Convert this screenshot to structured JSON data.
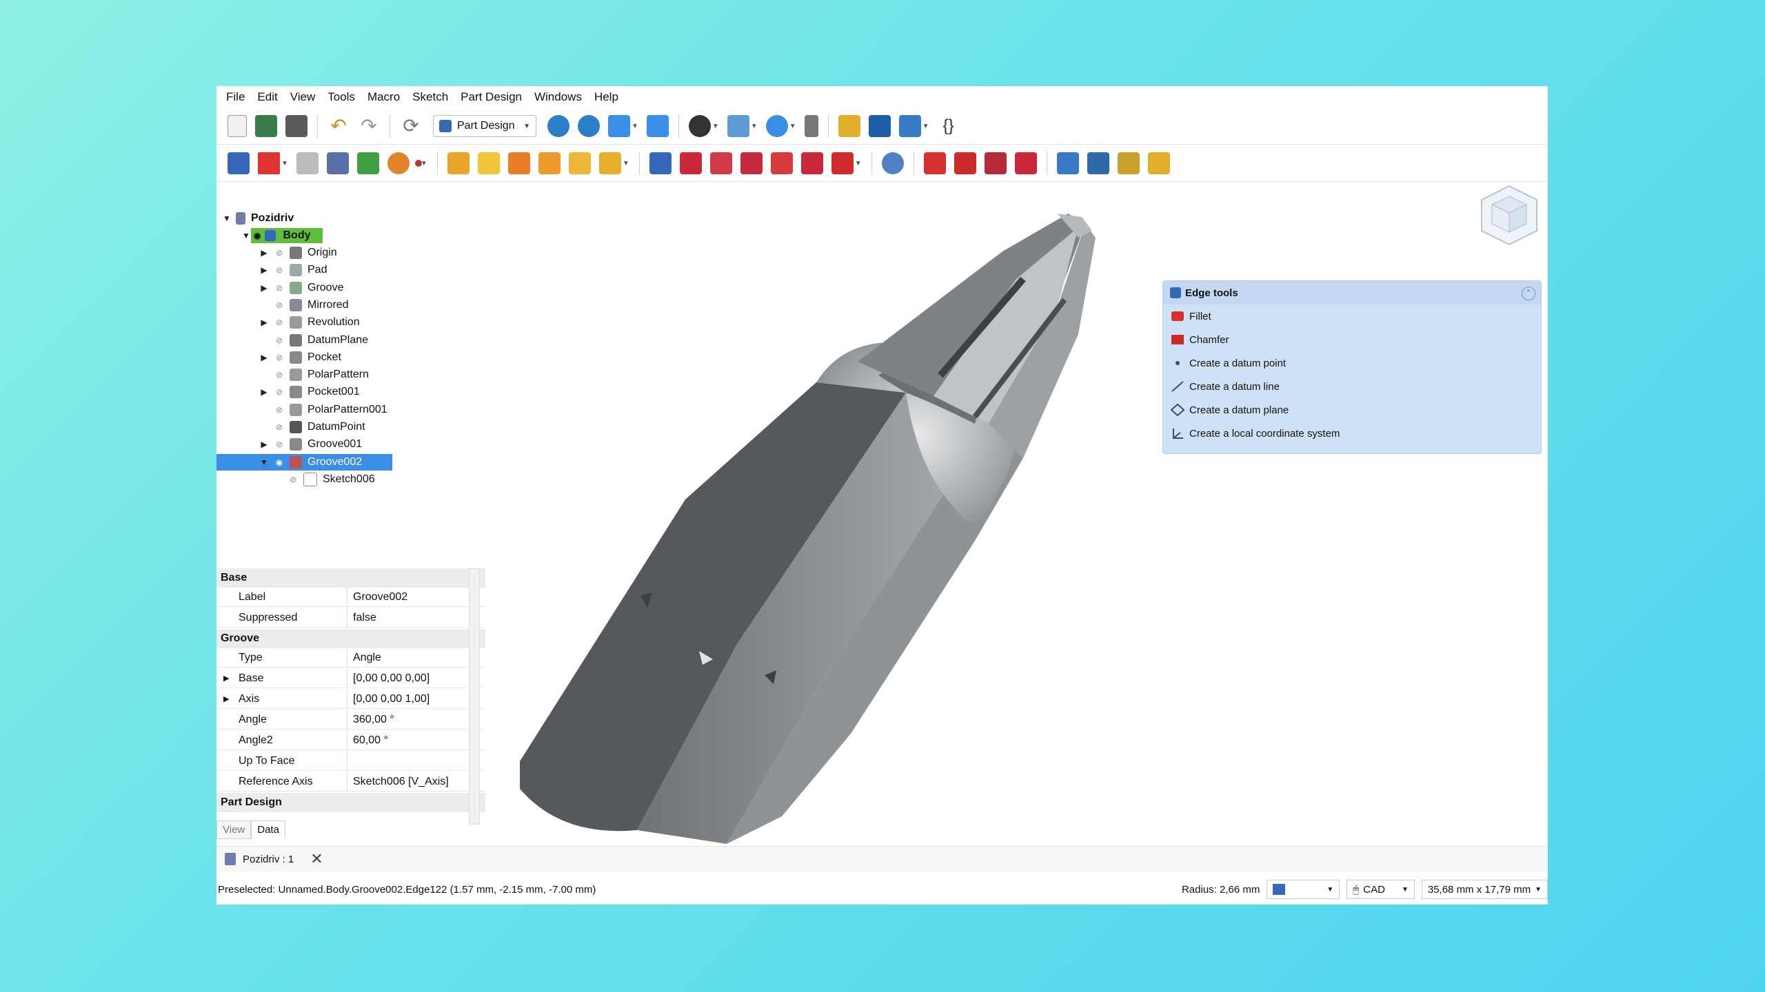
{
  "menu": [
    "File",
    "Edit",
    "View",
    "Tools",
    "Macro",
    "Sketch",
    "Part Design",
    "Windows",
    "Help"
  ],
  "toolbar": {
    "workbench": "Part Design"
  },
  "tree": {
    "root": "Pozidriv",
    "body": "Body",
    "items": [
      "Origin",
      "Pad",
      "Groove",
      "Mirrored",
      "Revolution",
      "DatumPlane",
      "Pocket",
      "PolarPattern",
      "Pocket001",
      "PolarPattern001",
      "DatumPoint",
      "Groove001",
      "Groove002"
    ],
    "child": "Sketch006"
  },
  "props": {
    "group_base": "Base",
    "label_key": "Label",
    "label_val": "Groove002",
    "suppressed_key": "Suppressed",
    "suppressed_val": "false",
    "group_groove": "Groove",
    "type_key": "Type",
    "type_val": "Angle",
    "base_key": "Base",
    "base_val": "[0,00 0,00 0,00]",
    "axis_key": "Axis",
    "axis_val": "[0,00 0,00 1,00]",
    "angle_key": "Angle",
    "angle_val": "360,00 °",
    "angle2_key": "Angle2",
    "angle2_val": "60,00 °",
    "upto_key": "Up To Face",
    "upto_val": "",
    "refaxis_key": "Reference Axis",
    "refaxis_val": "Sketch006 [V_Axis]",
    "group_pd": "Part Design",
    "tab_view": "View",
    "tab_data": "Data"
  },
  "edge_tools": {
    "title": "Edge tools",
    "items": [
      "Fillet",
      "Chamfer",
      "Create a datum point",
      "Create a datum line",
      "Create a datum plane",
      "Create a local coordinate system"
    ]
  },
  "doc_tab": "Pozidriv : 1",
  "status": {
    "preselected": "Preselected: Unnamed.Body.Groove002.Edge122 (1.57 mm, -2.15 mm, -7.00 mm)",
    "radius": "Radius: 2,66 mm",
    "nav_style": "CAD",
    "dimensions": "35,68 mm x 17,79 mm"
  },
  "colors": {
    "accent": "#3a8ee6",
    "body_highlight": "#5fbf3c",
    "model_gray": "#9aa0a6"
  }
}
